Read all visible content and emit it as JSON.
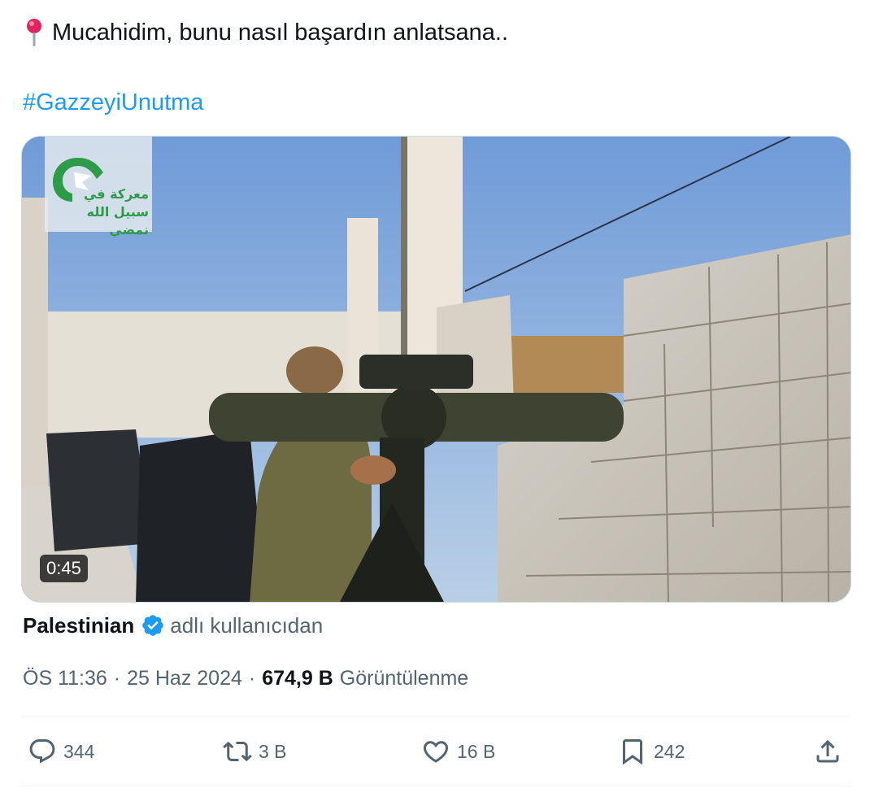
{
  "tweet": {
    "text": "Mucahidim, bunu nasıl başardın anlatsana..",
    "hashtag": "#GazzeyiUnutma",
    "media": {
      "duration": "0:45",
      "watermark_text": "معركة في سبيل الله نمضي"
    },
    "source": {
      "name": "Palestinian",
      "suffix": "adlı kullanıcıdan"
    },
    "meta": {
      "time": "ÖS 11:36",
      "separator": "·",
      "date": "25 Haz 2024",
      "views_count": "674,9 B",
      "views_label": "Görüntülenme"
    },
    "actions": {
      "replies": "344",
      "reposts": "3 B",
      "likes": "16 B",
      "bookmarks": "242"
    }
  },
  "colors": {
    "text": "#0f1419",
    "secondary": "#536471",
    "link": "#1d9bf0",
    "border": "#cfd9de",
    "verified": "#1d9bf0"
  }
}
